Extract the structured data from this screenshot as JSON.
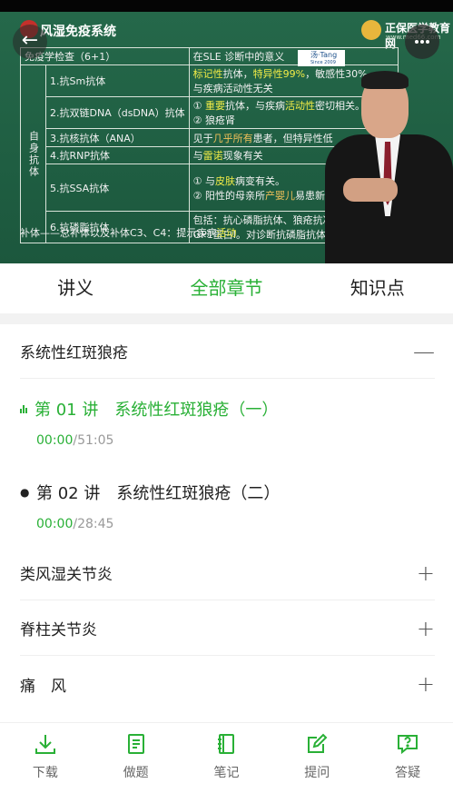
{
  "video": {
    "slide_title": "风湿免疫系统",
    "brand_name": "正保医学教育网",
    "brand_url": "www.med66.com",
    "stamp_text": "汤·Tang",
    "stamp_sub": "Since 2009",
    "table": {
      "header_left": "免疫学检查（6+1）",
      "header_right": "在SLE 诊断中的意义",
      "group_label": "自身抗体",
      "rows": [
        {
          "name": "1.抗Sm抗体",
          "desc_a": "标记性",
          "desc_b": "抗体，",
          "desc_c": "特异性99%",
          "desc_d": "，敏感性30%。",
          "desc_e": "与疾病活动性无关"
        },
        {
          "name": "2.抗双链DNA（dsDNA）抗体",
          "desc_a": "① ",
          "desc_b": "重要",
          "desc_c": "抗体，与疾病",
          "desc_d": "活动性",
          "desc_e": "密切相关。",
          "desc_f": "② 狼疮肾"
        },
        {
          "name": "3.抗核抗体（ANA）",
          "desc_a": "见于",
          "desc_b": "几乎所有",
          "desc_c": "患者，但特异性低"
        },
        {
          "name": "4.抗RNP抗体",
          "desc_a": "与",
          "desc_b": "雷诺",
          "desc_c": "现象有关"
        },
        {
          "name": "5.抗SSA抗体",
          "desc_a": "① 与",
          "desc_b": "皮肤",
          "desc_c": "病变有关。",
          "desc_d": "② 阳性的母亲所",
          "desc_e": "产婴儿",
          "desc_f": "易患新生儿红斑狼疮"
        },
        {
          "name": "6.抗磷脂抗体",
          "desc_a": "包括：抗心磷脂抗体、狼疮抗凝物、抗β2-GP1蛋白Ⅰ。对诊断抗磷脂抗体综合征有意义"
        }
      ],
      "footer_a": "补体——总补体以及补体C3、C4：提示疾病",
      "footer_b": "活动"
    }
  },
  "tabs": [
    {
      "label": "讲义",
      "active": false
    },
    {
      "label": "全部章节",
      "active": true
    },
    {
      "label": "知识点",
      "active": false
    }
  ],
  "chapters": [
    {
      "title": "系统性红斑狼疮",
      "toggle": "—",
      "lessons": [
        {
          "title": "第 01 讲　系统性红斑狼疮（一）",
          "current": "00:00",
          "total": "/51:05",
          "playing": true
        },
        {
          "title": "第 02 讲　系统性红斑狼疮（二）",
          "current": "00:00",
          "total": "/28:45",
          "playing": false
        }
      ]
    },
    {
      "title": "类风湿关节炎",
      "toggle": "+"
    },
    {
      "title": "脊柱关节炎",
      "toggle": "+"
    },
    {
      "title": "痛　风",
      "toggle": "+"
    }
  ],
  "bottom_bar": [
    {
      "label": "下载",
      "icon": "download-icon"
    },
    {
      "label": "做题",
      "icon": "exercise-icon"
    },
    {
      "label": "笔记",
      "icon": "notes-icon"
    },
    {
      "label": "提问",
      "icon": "ask-icon"
    },
    {
      "label": "答疑",
      "icon": "qa-icon"
    }
  ],
  "colors": {
    "accent": "#29b036",
    "board": "#1f5e42"
  }
}
